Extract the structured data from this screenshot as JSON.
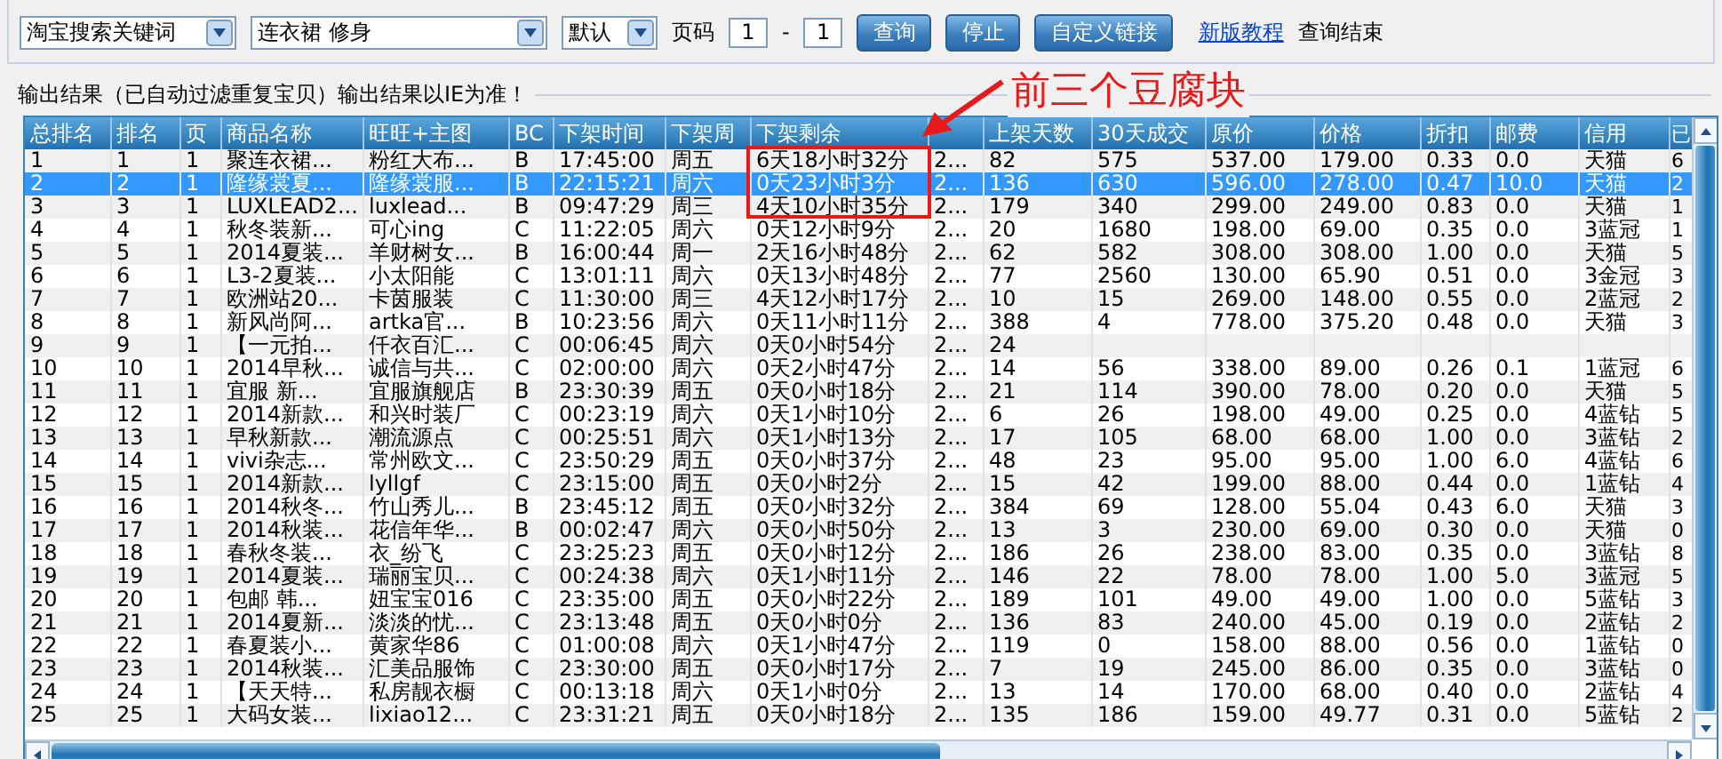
{
  "toolbar": {
    "search_type": "淘宝搜索关键词",
    "keyword": "连衣裙 修身",
    "sort": "默认",
    "page_label": "页码",
    "page_from": "1",
    "page_separator": "-",
    "page_to": "1",
    "buttons": [
      "查询",
      "停止",
      "自定义链接"
    ],
    "link": "新版教程",
    "status": "查询结束"
  },
  "output_label": "输出结果（已自动过滤重复宝贝）输出结果以IE为准！",
  "annotation": {
    "text": "前三个豆腐块"
  },
  "table": {
    "columns": [
      "总排名",
      "排名",
      "页",
      "商品名称",
      "旺旺+主图",
      "BC",
      "下架时间",
      "下架周",
      "下架剩余",
      null,
      "上架天数",
      "30天成交",
      "原价",
      "价格",
      "折扣",
      "邮费",
      "信用",
      "已"
    ],
    "rows": [
      {
        "selected": false,
        "cells": [
          "1",
          "1",
          "1",
          "聚连衣裙...",
          "粉红大布...",
          "B",
          "17:45:00",
          "周五",
          "6天18小时32分",
          "2...",
          "82",
          "575",
          "537.00",
          "179.00",
          "0.33",
          "0.0",
          "天猫",
          "6"
        ]
      },
      {
        "selected": true,
        "cells": [
          "2",
          "2",
          "1",
          "隆缘裳夏...",
          "隆缘裳服...",
          "B",
          "22:15:21",
          "周六",
          "0天23小时3分",
          "2...",
          "136",
          "630",
          "596.00",
          "278.00",
          "0.47",
          "10.0",
          "天猫",
          "2"
        ]
      },
      {
        "selected": false,
        "cells": [
          "3",
          "3",
          "1",
          "LUXLEAD2...",
          "luxlead...",
          "B",
          "09:47:29",
          "周三",
          "4天10小时35分",
          "2...",
          "179",
          "340",
          "299.00",
          "249.00",
          "0.83",
          "0.0",
          "天猫",
          "1"
        ]
      },
      {
        "selected": false,
        "cells": [
          "4",
          "4",
          "1",
          "秋冬装新...",
          "可心ing",
          "C",
          "11:22:05",
          "周六",
          "0天12小时9分",
          "2...",
          "20",
          "1680",
          "198.00",
          "69.00",
          "0.35",
          "0.0",
          "3蓝冠",
          "1"
        ]
      },
      {
        "selected": false,
        "cells": [
          "5",
          "5",
          "1",
          "2014夏装...",
          "羊财树女...",
          "B",
          "16:00:44",
          "周一",
          "2天16小时48分",
          "2...",
          "62",
          "582",
          "308.00",
          "308.00",
          "1.00",
          "0.0",
          "天猫",
          "5"
        ]
      },
      {
        "selected": false,
        "cells": [
          "6",
          "6",
          "1",
          "L3-2夏装...",
          "小太阳能",
          "C",
          "13:01:11",
          "周六",
          "0天13小时48分",
          "2...",
          "77",
          "2560",
          "130.00",
          "65.90",
          "0.51",
          "0.0",
          "3金冠",
          "3"
        ]
      },
      {
        "selected": false,
        "cells": [
          "7",
          "7",
          "1",
          "欧洲站20...",
          "卡茵服装",
          "C",
          "11:30:00",
          "周三",
          "4天12小时17分",
          "2...",
          "10",
          "15",
          "269.00",
          "148.00",
          "0.55",
          "0.0",
          "2蓝冠",
          "2"
        ]
      },
      {
        "selected": false,
        "cells": [
          "8",
          "8",
          "1",
          "新风尚阿...",
          "artka官...",
          "B",
          "10:23:56",
          "周六",
          "0天11小时11分",
          "2...",
          "388",
          "4",
          "778.00",
          "375.20",
          "0.48",
          "0.0",
          "天猫",
          "3"
        ]
      },
      {
        "selected": false,
        "cells": [
          "9",
          "9",
          "1",
          "【一元拍...",
          "仟衣百汇...",
          "C",
          "00:06:45",
          "周六",
          "0天0小时54分",
          "2...",
          "24",
          null,
          null,
          null,
          null,
          null,
          null,
          null
        ]
      },
      {
        "selected": false,
        "cells": [
          "10",
          "10",
          "1",
          "2014早秋...",
          "诚信与共...",
          "C",
          "02:00:00",
          "周六",
          "0天2小时47分",
          "2...",
          "14",
          "56",
          "338.00",
          "89.00",
          "0.26",
          "0.1",
          "1蓝冠",
          "6"
        ]
      },
      {
        "selected": false,
        "cells": [
          "11",
          "11",
          "1",
          "宜服 新...",
          "宜服旗舰店",
          "B",
          "23:30:39",
          "周五",
          "0天0小时18分",
          "2...",
          "21",
          "114",
          "390.00",
          "78.00",
          "0.20",
          "0.0",
          "天猫",
          "5"
        ]
      },
      {
        "selected": false,
        "cells": [
          "12",
          "12",
          "1",
          "2014新款...",
          "和兴时装厂",
          "C",
          "00:23:19",
          "周六",
          "0天1小时10分",
          "2...",
          "6",
          "26",
          "198.00",
          "49.00",
          "0.25",
          "0.0",
          "4蓝钻",
          "5"
        ]
      },
      {
        "selected": false,
        "cells": [
          "13",
          "13",
          "1",
          "早秋新款...",
          "潮流源点",
          "C",
          "00:25:51",
          "周六",
          "0天1小时13分",
          "2...",
          "17",
          "105",
          "68.00",
          "68.00",
          "1.00",
          "0.0",
          "3蓝钻",
          "2"
        ]
      },
      {
        "selected": false,
        "cells": [
          "14",
          "14",
          "1",
          "vivi杂志...",
          "常州欧文...",
          "C",
          "23:50:29",
          "周五",
          "0天0小时37分",
          "2...",
          "48",
          "23",
          "95.00",
          "95.00",
          "1.00",
          "6.0",
          "4蓝钻",
          "6"
        ]
      },
      {
        "selected": false,
        "cells": [
          "15",
          "15",
          "1",
          "2014新款...",
          "lyllgf",
          "C",
          "23:15:00",
          "周五",
          "0天0小时2分",
          "2...",
          "15",
          "42",
          "199.00",
          "88.00",
          "0.44",
          "0.0",
          "1蓝钻",
          "4"
        ]
      },
      {
        "selected": false,
        "cells": [
          "16",
          "16",
          "1",
          "2014秋冬...",
          "竹山秀儿...",
          "B",
          "23:45:12",
          "周五",
          "0天0小时32分",
          "2...",
          "384",
          "69",
          "128.00",
          "55.04",
          "0.43",
          "6.0",
          "天猫",
          "3"
        ]
      },
      {
        "selected": false,
        "cells": [
          "17",
          "17",
          "1",
          "2014秋装...",
          "花信年华...",
          "B",
          "00:02:47",
          "周六",
          "0天0小时50分",
          "2...",
          "13",
          "3",
          "230.00",
          "69.00",
          "0.30",
          "0.0",
          "天猫",
          "0"
        ]
      },
      {
        "selected": false,
        "cells": [
          "18",
          "18",
          "1",
          "春秋冬装...",
          "衣_纷飞",
          "C",
          "23:25:23",
          "周五",
          "0天0小时12分",
          "2...",
          "186",
          "26",
          "238.00",
          "83.00",
          "0.35",
          "0.0",
          "3蓝钻",
          "8"
        ]
      },
      {
        "selected": false,
        "cells": [
          "19",
          "19",
          "1",
          "2014夏装...",
          "瑞丽宝贝...",
          "C",
          "00:24:38",
          "周六",
          "0天1小时11分",
          "2...",
          "146",
          "22",
          "78.00",
          "78.00",
          "1.00",
          "5.0",
          "3蓝冠",
          "5"
        ]
      },
      {
        "selected": false,
        "cells": [
          "20",
          "20",
          "1",
          "包邮 韩...",
          "妞宝宝016",
          "C",
          "23:35:00",
          "周五",
          "0天0小时22分",
          "2...",
          "189",
          "101",
          "49.00",
          "49.00",
          "1.00",
          "0.0",
          "5蓝钻",
          "3"
        ]
      },
      {
        "selected": false,
        "cells": [
          "21",
          "21",
          "1",
          "2014夏新...",
          "淡淡的忧...",
          "C",
          "23:13:48",
          "周五",
          "0天0小时0分",
          "2...",
          "136",
          "83",
          "240.00",
          "45.00",
          "0.19",
          "0.0",
          "2蓝钻",
          "2"
        ]
      },
      {
        "selected": false,
        "cells": [
          "22",
          "22",
          "1",
          "春夏装小...",
          "黄家华86",
          "C",
          "01:00:08",
          "周六",
          "0天1小时47分",
          "2...",
          "119",
          "0",
          "158.00",
          "88.00",
          "0.56",
          "0.0",
          "1蓝钻",
          "0"
        ]
      },
      {
        "selected": false,
        "cells": [
          "23",
          "23",
          "1",
          "2014秋装...",
          "汇美品服饰",
          "C",
          "23:30:00",
          "周五",
          "0天0小时17分",
          "2...",
          "7",
          "19",
          "245.00",
          "86.00",
          "0.35",
          "0.0",
          "3蓝钻",
          "0"
        ]
      },
      {
        "selected": false,
        "cells": [
          "24",
          "24",
          "1",
          "【天天特...",
          "私房靓衣橱",
          "C",
          "00:13:18",
          "周六",
          "0天1小时0分",
          "2...",
          "13",
          "14",
          "170.00",
          "68.00",
          "0.40",
          "0.0",
          "2蓝钻",
          "4"
        ]
      },
      {
        "selected": false,
        "cells": [
          "25",
          "25",
          "1",
          "大码女装...",
          "lixiao12...",
          "C",
          "23:31:21",
          "周五",
          "0天0小时18分",
          "2...",
          "135",
          "186",
          "159.00",
          "49.77",
          "0.31",
          "0.0",
          "5蓝钻",
          "2"
        ]
      }
    ]
  }
}
